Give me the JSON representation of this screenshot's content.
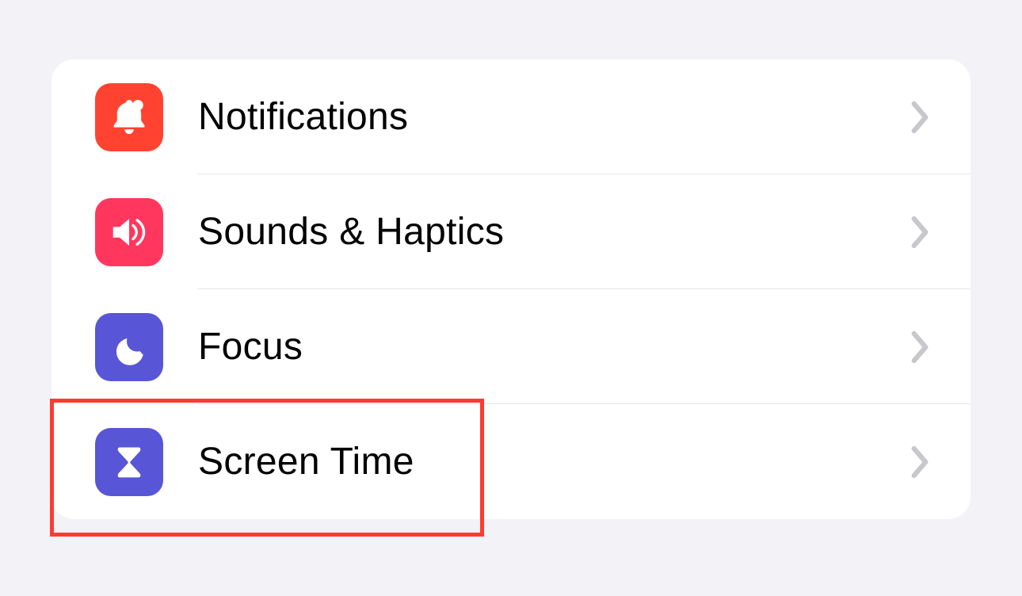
{
  "settings": {
    "items": [
      {
        "label": "Notifications",
        "icon": "notifications",
        "color": "#ff4330"
      },
      {
        "label": "Sounds & Haptics",
        "icon": "sounds",
        "color": "#ff375f"
      },
      {
        "label": "Focus",
        "icon": "focus",
        "color": "#5856d6"
      },
      {
        "label": "Screen Time",
        "icon": "screentime",
        "color": "#5856d6"
      }
    ]
  },
  "highlight": {
    "target": "Screen Time",
    "color": "#ff3b30"
  }
}
